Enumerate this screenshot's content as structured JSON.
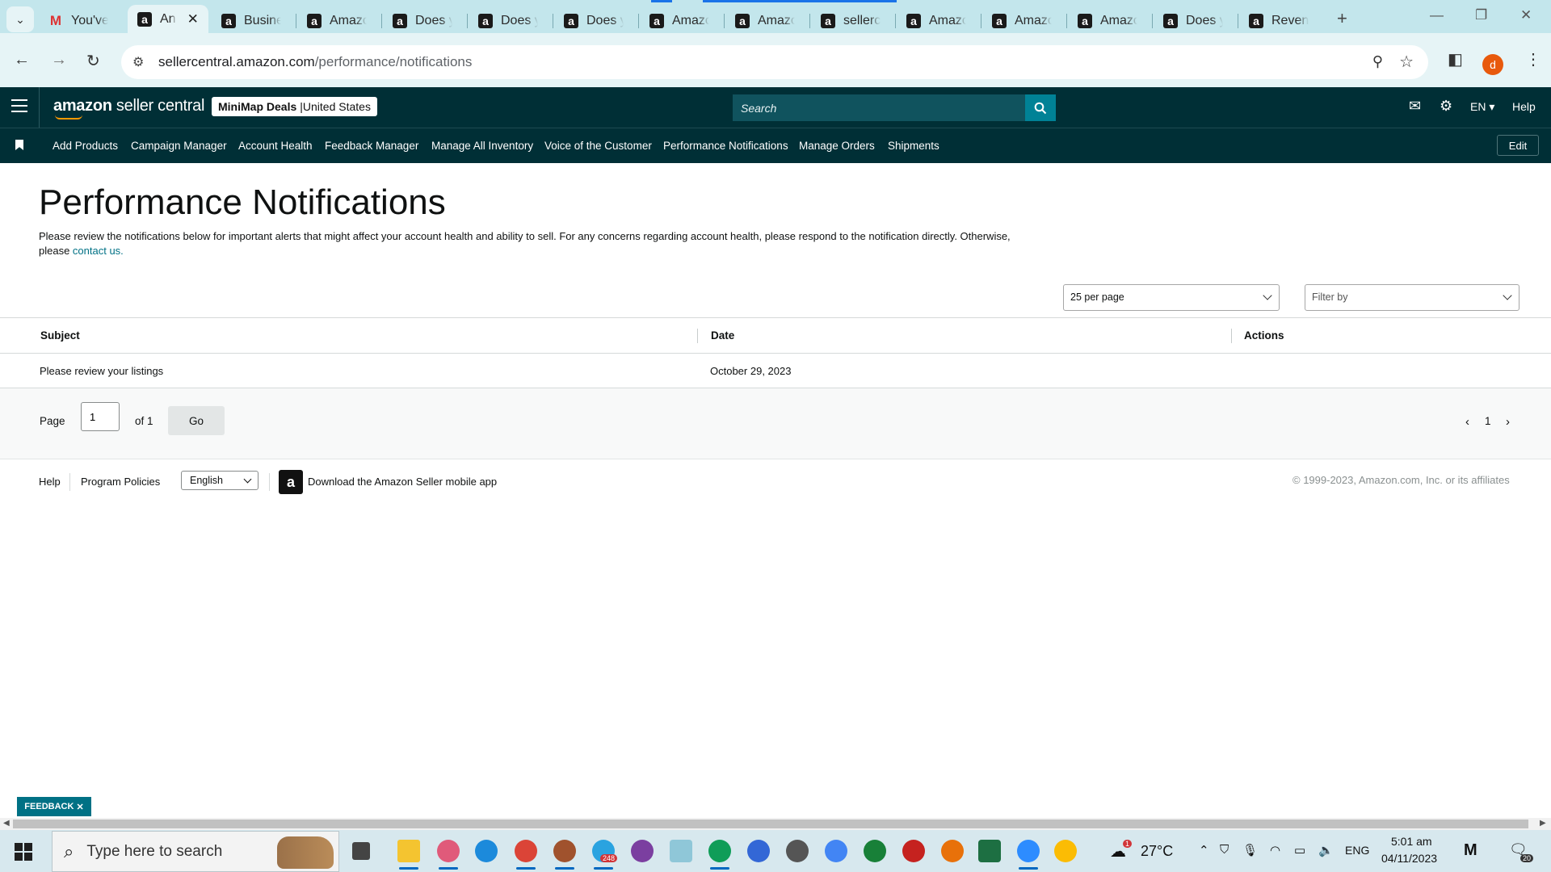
{
  "browser": {
    "tabs": [
      {
        "title": "You've",
        "icon": "gmail-icon"
      },
      {
        "title": "An",
        "icon": "amazon-icon",
        "active": true
      },
      {
        "title": "Busine",
        "icon": "amazon-icon"
      },
      {
        "title": "Amazo",
        "icon": "amazon-icon"
      },
      {
        "title": "Does y",
        "icon": "amazon-icon"
      },
      {
        "title": "Does y",
        "icon": "amazon-icon"
      },
      {
        "title": "Does y",
        "icon": "amazon-icon"
      },
      {
        "title": "Amazo",
        "icon": "amazon-icon"
      },
      {
        "title": "Amazo",
        "icon": "amazon-icon"
      },
      {
        "title": "sellerc",
        "icon": "amazon-icon"
      },
      {
        "title": "Amazo",
        "icon": "amazon-icon"
      },
      {
        "title": "Amazo",
        "icon": "amazon-icon"
      },
      {
        "title": "Amazo",
        "icon": "amazon-icon"
      },
      {
        "title": "Does y",
        "icon": "amazon-icon"
      },
      {
        "title": "Reven",
        "icon": "amazon-icon"
      }
    ],
    "url_host": "sellercentral.amazon.com",
    "url_path": "/performance/notifications",
    "profile_initial": "d",
    "accent_color": "#1a73e8"
  },
  "header": {
    "logo_left": "amazon",
    "logo_right": " seller central",
    "account_name": "MiniMap Deals",
    "account_sep": " | ",
    "account_region": "United States",
    "search_placeholder": "Search",
    "language": "EN",
    "help": "Help",
    "brand_color": "#002f36"
  },
  "nav": {
    "items": [
      "Add Products",
      "Campaign Manager",
      "Account Health",
      "Feedback Manager",
      "Manage All Inventory",
      "Voice of the Customer",
      "Performance Notifications",
      "Manage Orders",
      "Shipments"
    ],
    "edit": "Edit"
  },
  "main": {
    "title": "Performance Notifications",
    "description": "Please review the notifications below for important alerts that might affect your account health and ability to sell. For any concerns regarding account health, please respond to the notification directly. Otherwise, please ",
    "contact_link": "contact us.",
    "per_page": "25 per page",
    "filter_placeholder": "Filter by",
    "columns": [
      "Subject",
      "Date",
      "Actions"
    ],
    "rows": [
      {
        "subject": "Please review your listings",
        "date": "October 29, 2023",
        "actions": ""
      }
    ],
    "pager": {
      "page_label": "Page",
      "page_value": "1",
      "of_label": "of 1",
      "go": "Go",
      "current": "1"
    },
    "link_color": "#007185"
  },
  "footer": {
    "help": "Help",
    "policies": "Program Policies",
    "language": "English",
    "app_link": "Download the Amazon Seller mobile app",
    "copyright": "© 1999-2023, Amazon.com, Inc. or its affiliates"
  },
  "feedback": "FEEDBACK",
  "taskbar": {
    "search_placeholder": "Type here to search",
    "telegram_badge": "248",
    "weather_badge": "1",
    "temperature": "27°C",
    "language": "ENG",
    "time": "5:01 am",
    "date": "04/11/2023",
    "notifications": "20"
  }
}
